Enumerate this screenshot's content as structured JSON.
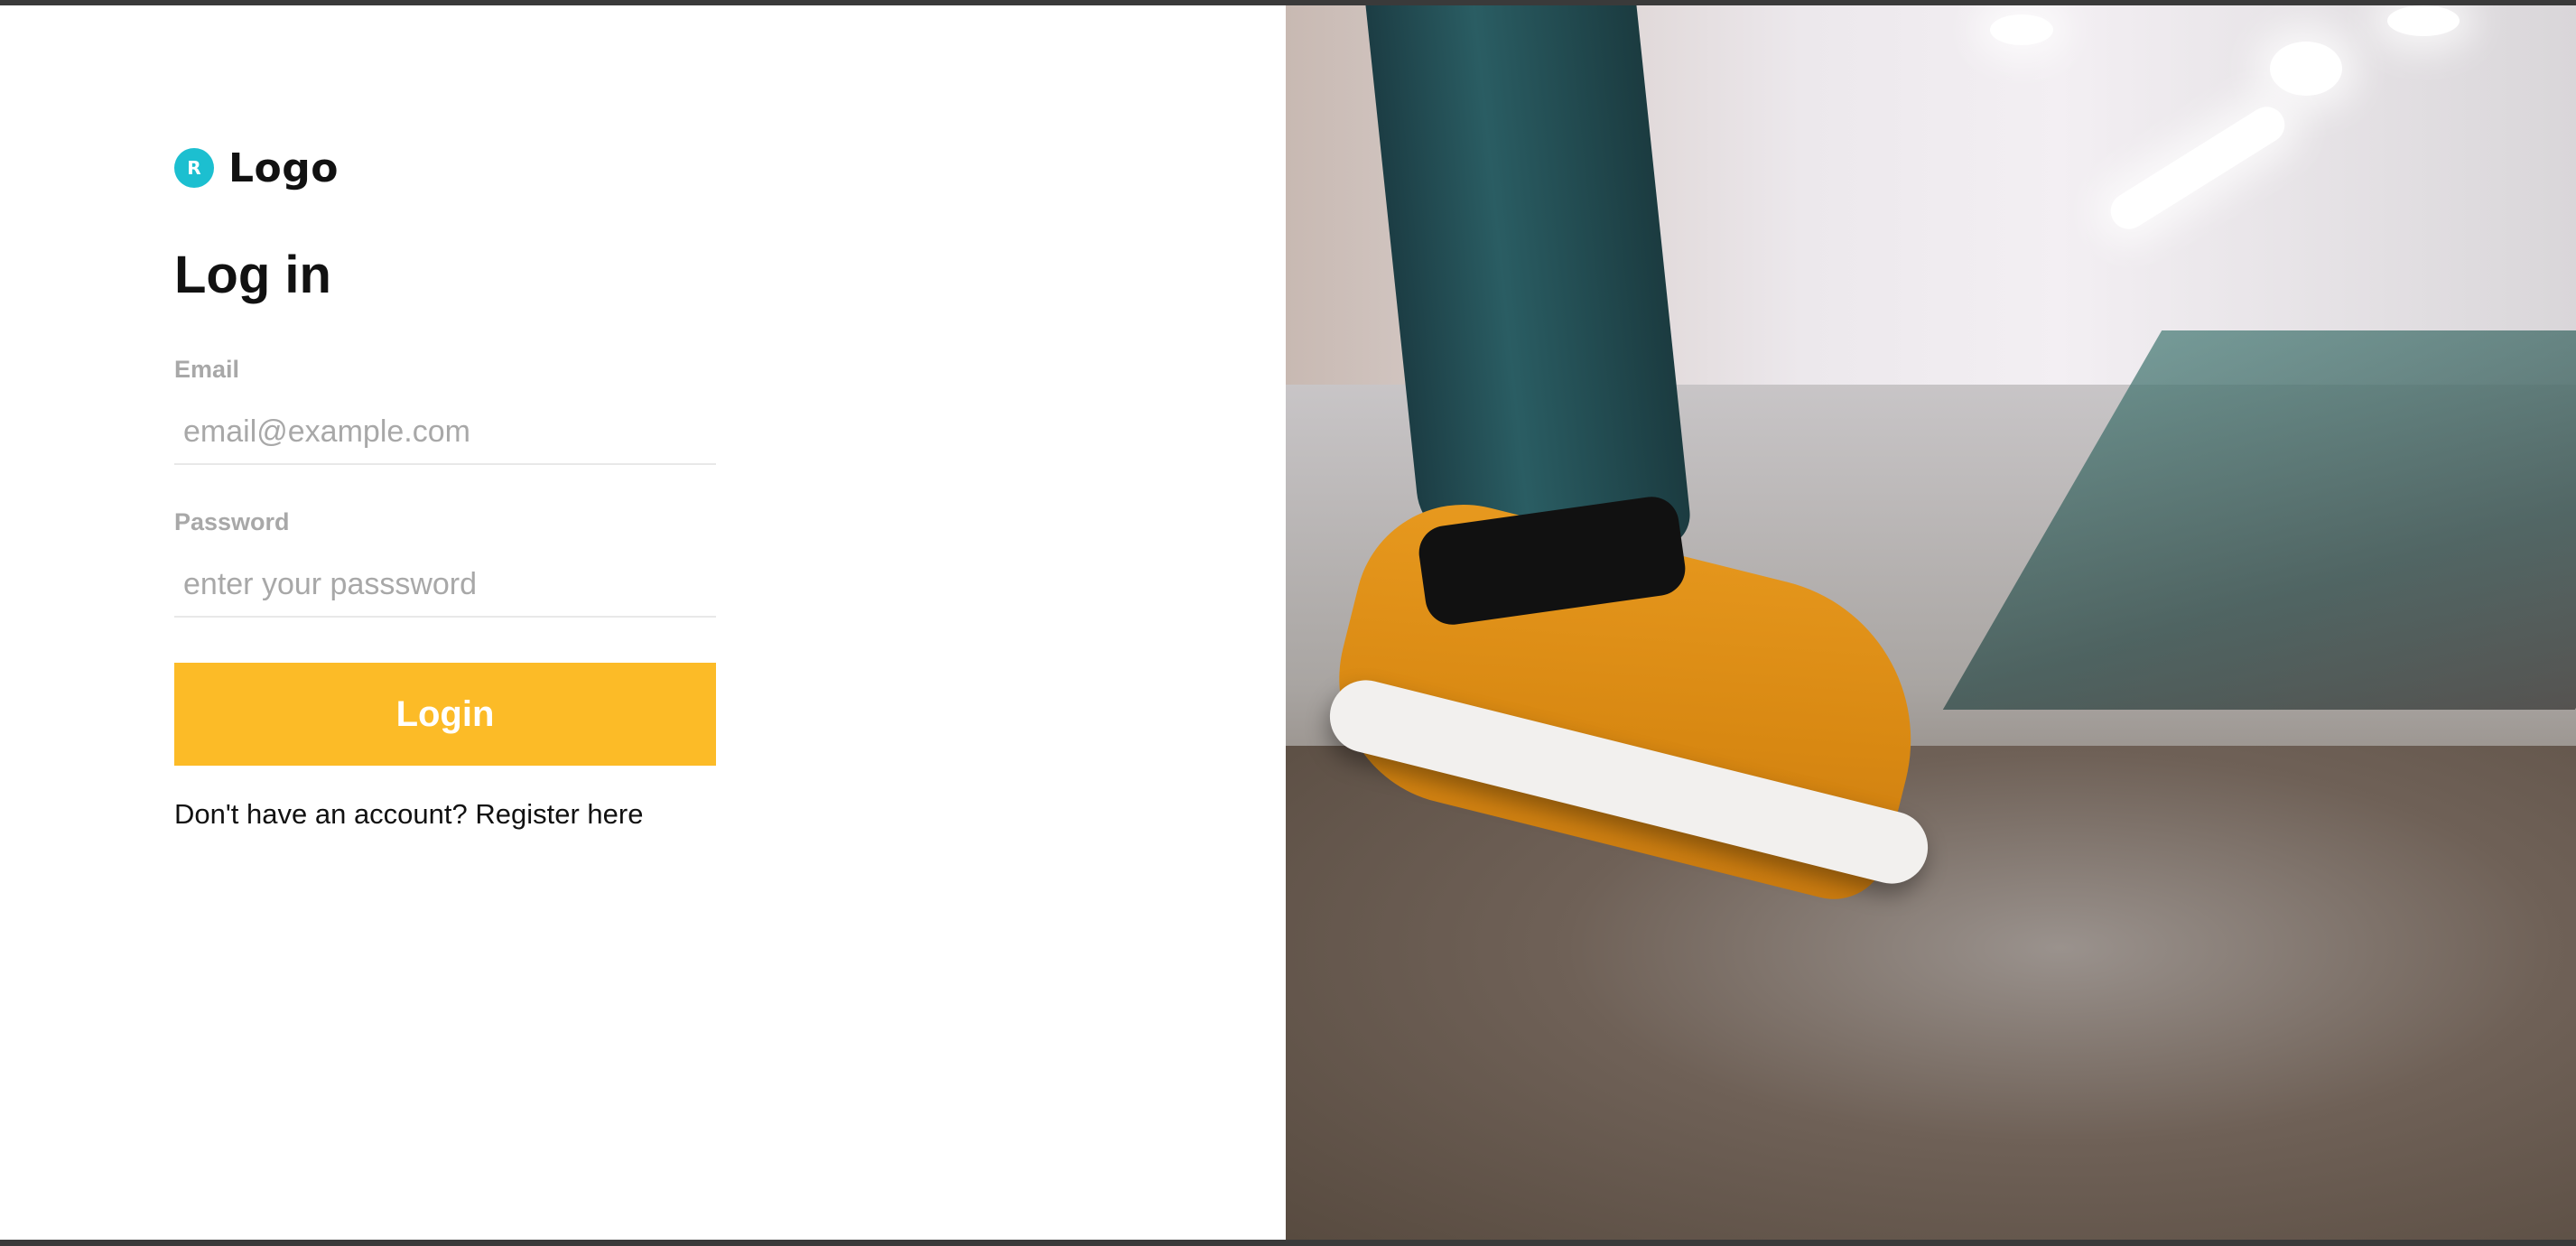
{
  "brand": {
    "badge_letter": "R",
    "logo_text": "Logo",
    "accent_color": "#1cbfd0"
  },
  "form": {
    "title": "Log in",
    "email": {
      "label": "Email",
      "placeholder": "email@example.com",
      "value": ""
    },
    "password": {
      "label": "Password",
      "placeholder": "enter your passsword",
      "value": ""
    },
    "login_button": {
      "label": "Login",
      "color": "#fcbb27"
    },
    "register_text": "Don't have an account? Register here"
  },
  "hero_image": {
    "description_icon": "sneaker-photo",
    "alt": ""
  }
}
